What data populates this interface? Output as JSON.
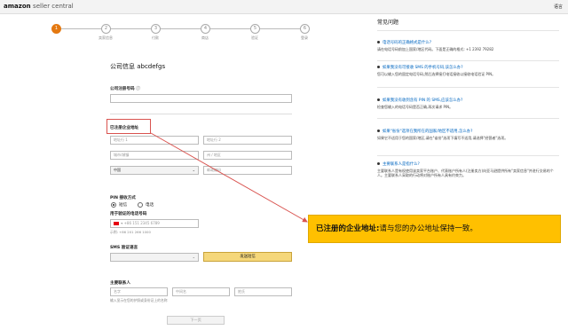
{
  "header": {
    "logo_main": "amazon",
    "logo_sub": "seller central",
    "language": "语言"
  },
  "stepper": {
    "steps": [
      {
        "num": "1",
        "label": ""
      },
      {
        "num": "2",
        "label": "卖家信息"
      },
      {
        "num": "3",
        "label": "付款"
      },
      {
        "num": "4",
        "label": "商店"
      },
      {
        "num": "5",
        "label": "验证"
      },
      {
        "num": "6",
        "label": "登录"
      }
    ]
  },
  "form": {
    "company_title": "公司信息 abcdefgs",
    "company_reg_label": "公司注册号码",
    "address_label": "已注册企业地址",
    "address_line1": "地址行 1",
    "address_line2": "地址行 2",
    "city": "城市/城镇",
    "state": "州 / 地区",
    "country": "中国",
    "postal": "邮政编码",
    "pin_label": "PIN 接收方式",
    "pin_sms": "短信",
    "pin_call": "电话",
    "phone_label": "用于验证的电话号码",
    "phone_value": "+86 151 2345 6789",
    "phone_example": "示例: +86 201 266 1000",
    "sms_lang_label": "SMS 验证语言",
    "sms_button": "发送短信",
    "contact_label": "主要联系人",
    "first_name": "名字",
    "middle_name": "中间名",
    "last_name": "姓氏",
    "contact_hint": "输入显示在您的护照或身份证上的名称",
    "next_button": "下一页"
  },
  "faq": {
    "title": "常见问题",
    "items": [
      {
        "q": "电话号码的正确格式是什么?",
        "a": "请在电话号码前加上国家/地区代码。下面是正确的格式: +1 2392 79282"
      },
      {
        "q": "如果我没有可接收 SMS 的手机号码,该怎么办?",
        "a": "您可以输入您的固定电话号码,然后选择接打电话接收以接收电话验证 PIN。"
      },
      {
        "q": "如果我没有收到含有 PIN 的 SMS,应该怎么办?",
        "a": "检查您输入的电话号码是否正确,再次请求 PIN。"
      },
      {
        "q": "如果\"省份\"选项在我所在的国家/地区不适用,怎么办?",
        "a": "如果它不适用于您的国家/地区,请在\"省份\"选项下填写不适用,请选择\"经营者\"选项。"
      },
      {
        "q": "主要联系人是指什么?",
        "a": "主要联系人是有权使用该卖家平台账户、代表账户所有人(注册卖方)向亚马逊提供所有\"卖家信息\"并进行交易的个人。主要联系人采取的行动将对账户所有人具有约束力。"
      }
    ]
  },
  "callout": {
    "bold": "已注册的企业地址:",
    "text": "请与您的办公地址保持一致。"
  },
  "colors": {
    "accent_orange": "#e47911",
    "highlight_red": "#d9534f",
    "callout_yellow": "#ffc000",
    "link_blue": "#0066c0"
  }
}
